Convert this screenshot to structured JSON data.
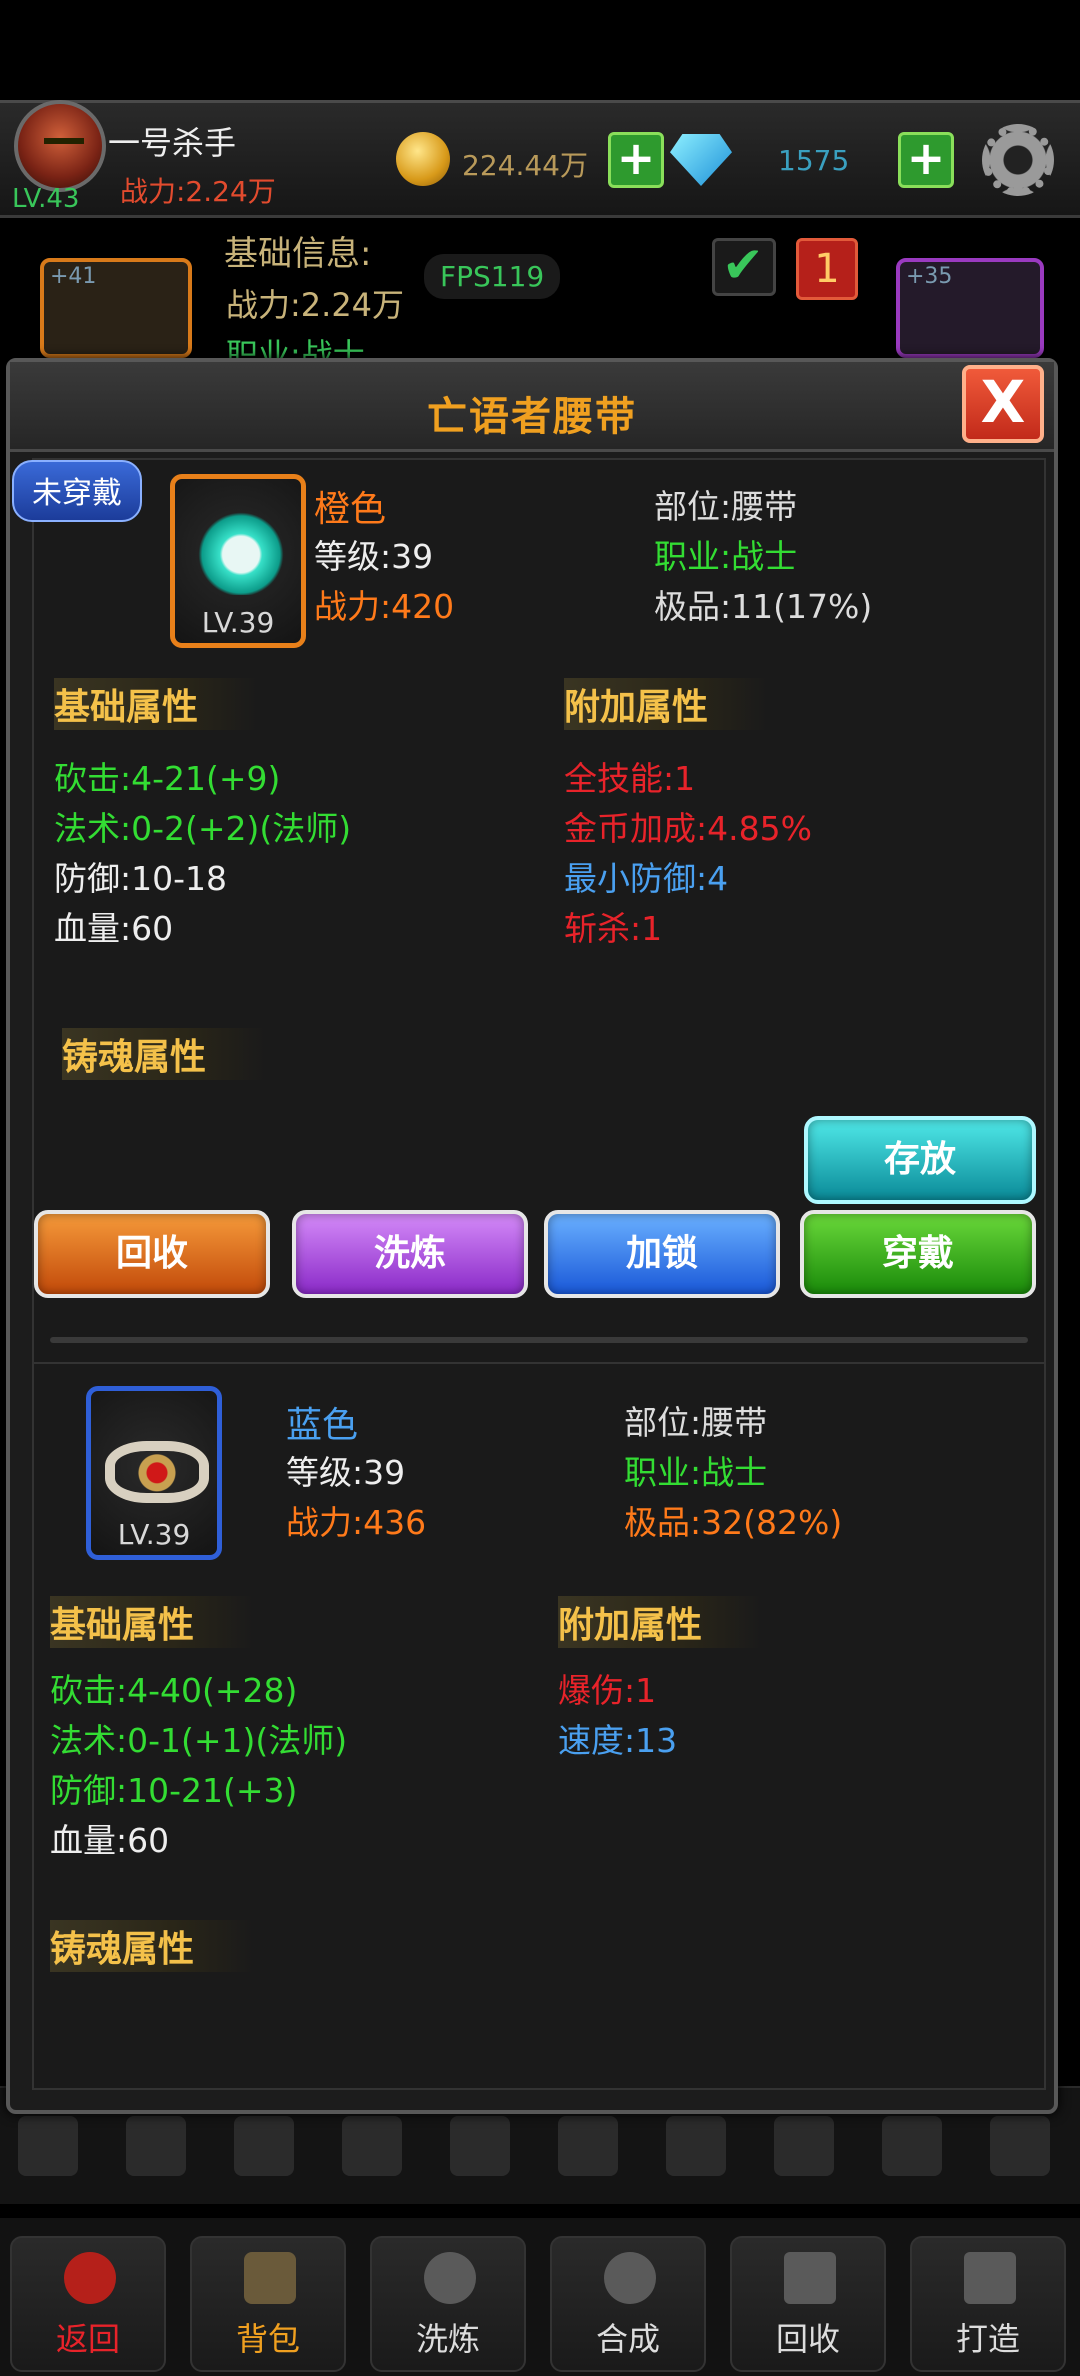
{
  "player": {
    "name": "一号杀手",
    "power": "战力:2.24万",
    "level": "LV.43",
    "gold": "224.44万",
    "diamonds": "1575",
    "fps": "FPS119"
  },
  "background_info": {
    "title": "基础信息:",
    "power": "战力:2.24万",
    "class": "职业:战士",
    "left_slot_plus": "+41",
    "right_slot_plus": "+35",
    "badge_number": "1"
  },
  "dialog": {
    "title": "亡语者腰带",
    "close_symbol": "X"
  },
  "equipped_item": {
    "badge": "未穿戴",
    "quality": "橙色",
    "level_text": "等级:39",
    "power": "战力:420",
    "item_level": "LV.39",
    "slot": "部位:腰带",
    "class": "职业:战士",
    "grade": "极品:11(17%)",
    "base_title": "基础属性",
    "base_stats": [
      "砍击:4-21(+9)",
      "法术:0-2(+2)(法师)",
      "防御:10-18",
      "血量:60"
    ],
    "extra_title": "附加属性",
    "extra_stats": [
      "全技能:1",
      "金币加成:4.85%",
      "最小防御:4",
      "斩杀:1"
    ],
    "soul_title": "铸魂属性"
  },
  "actions": {
    "store": "存放",
    "recycle": "回收",
    "refine": "洗炼",
    "lock": "加锁",
    "wear": "穿戴"
  },
  "compare_item": {
    "quality": "蓝色",
    "level_text": "等级:39",
    "power": "战力:436",
    "item_level": "LV.39",
    "slot": "部位:腰带",
    "class": "职业:战士",
    "grade": "极品:32(82%)",
    "base_title": "基础属性",
    "base_stats": [
      "砍击:4-40(+28)",
      "法术:0-1(+1)(法师)",
      "防御:10-21(+3)",
      "血量:60"
    ],
    "extra_title": "附加属性",
    "extra_stats": [
      "爆伤:1",
      "速度:13"
    ],
    "soul_title": "铸魂属性"
  },
  "bottom_nav": [
    "返回",
    "背包",
    "洗炼",
    "合成",
    "回收",
    "打造"
  ]
}
